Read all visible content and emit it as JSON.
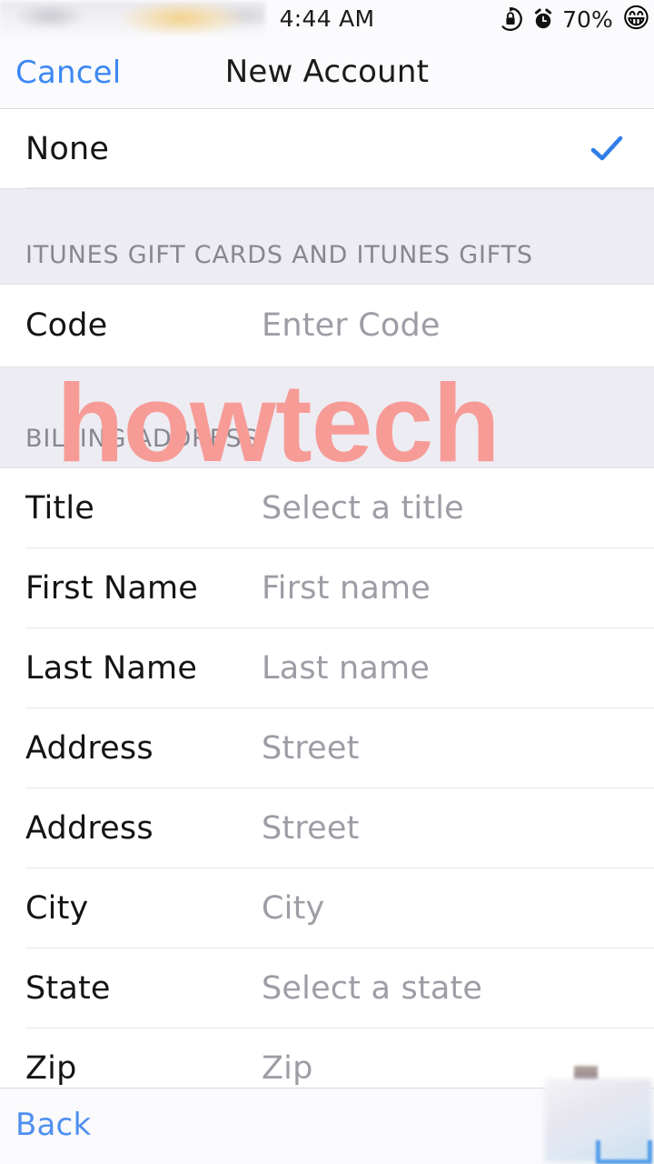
{
  "status_bar": {
    "time": "4:44 AM",
    "battery_percent": "70%",
    "emoji": "😁",
    "icons": [
      "rotation-lock-icon",
      "alarm-clock-icon"
    ]
  },
  "nav_bar": {
    "cancel_label": "Cancel",
    "title": "New Account"
  },
  "payment_section": {
    "rows": [
      {
        "label": "None",
        "value": "",
        "checked": true
      }
    ]
  },
  "gift_section": {
    "header": "ITUNES GIFT CARDS AND ITUNES GIFTS",
    "rows": [
      {
        "label": "Code",
        "value": "Enter Code",
        "checked": false
      }
    ]
  },
  "billing_section": {
    "header": "BILLING ADDRESS",
    "rows": [
      {
        "label": "Title",
        "value": "Select a title"
      },
      {
        "label": "First Name",
        "value": "First name"
      },
      {
        "label": "Last Name",
        "value": "Last name"
      },
      {
        "label": "Address",
        "value": "Street"
      },
      {
        "label": "Address",
        "value": "Street"
      },
      {
        "label": "City",
        "value": "City"
      },
      {
        "label": "State",
        "value": "Select a state"
      },
      {
        "label": "Zip",
        "value": "Zip"
      }
    ]
  },
  "bottom_bar": {
    "back_label": "Back"
  },
  "watermark": {
    "text": "howtech",
    "color": "#f79b97"
  },
  "colors": {
    "link_blue": "#3d88f5",
    "checkmark_blue": "#2f7ee8",
    "section_header_bg": "#edecf2",
    "placeholder_gray": "#9e9da6"
  }
}
